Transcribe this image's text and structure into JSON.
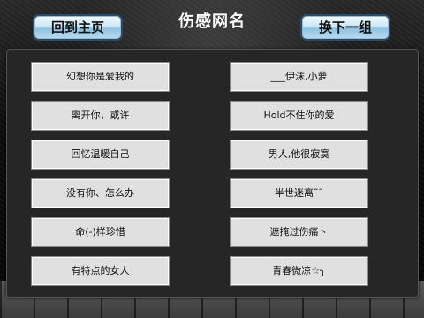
{
  "header": {
    "home_label": "回到主页",
    "title": "伤感网名",
    "next_label": "换下一组"
  },
  "names": [
    "幻想你是爱我的",
    "___伊沫,小萝",
    "离开你，或许",
    "Hold不住你的爱",
    "回忆温暖自己",
    "男人,他很寂寞",
    "没有你、怎么办",
    "半世迷离˜˜",
    "命(-)样珍惜",
    "遮掩过伤痛丶",
    "有特点的女人",
    "青春微凉☆╮"
  ],
  "colors": {
    "button_gradient_top": "#f4fbff",
    "button_gradient_bottom": "#8fc2e0",
    "panel_bg": "#262626",
    "cell_bg": "#e0e0e0",
    "title_color": "#ffffff"
  }
}
